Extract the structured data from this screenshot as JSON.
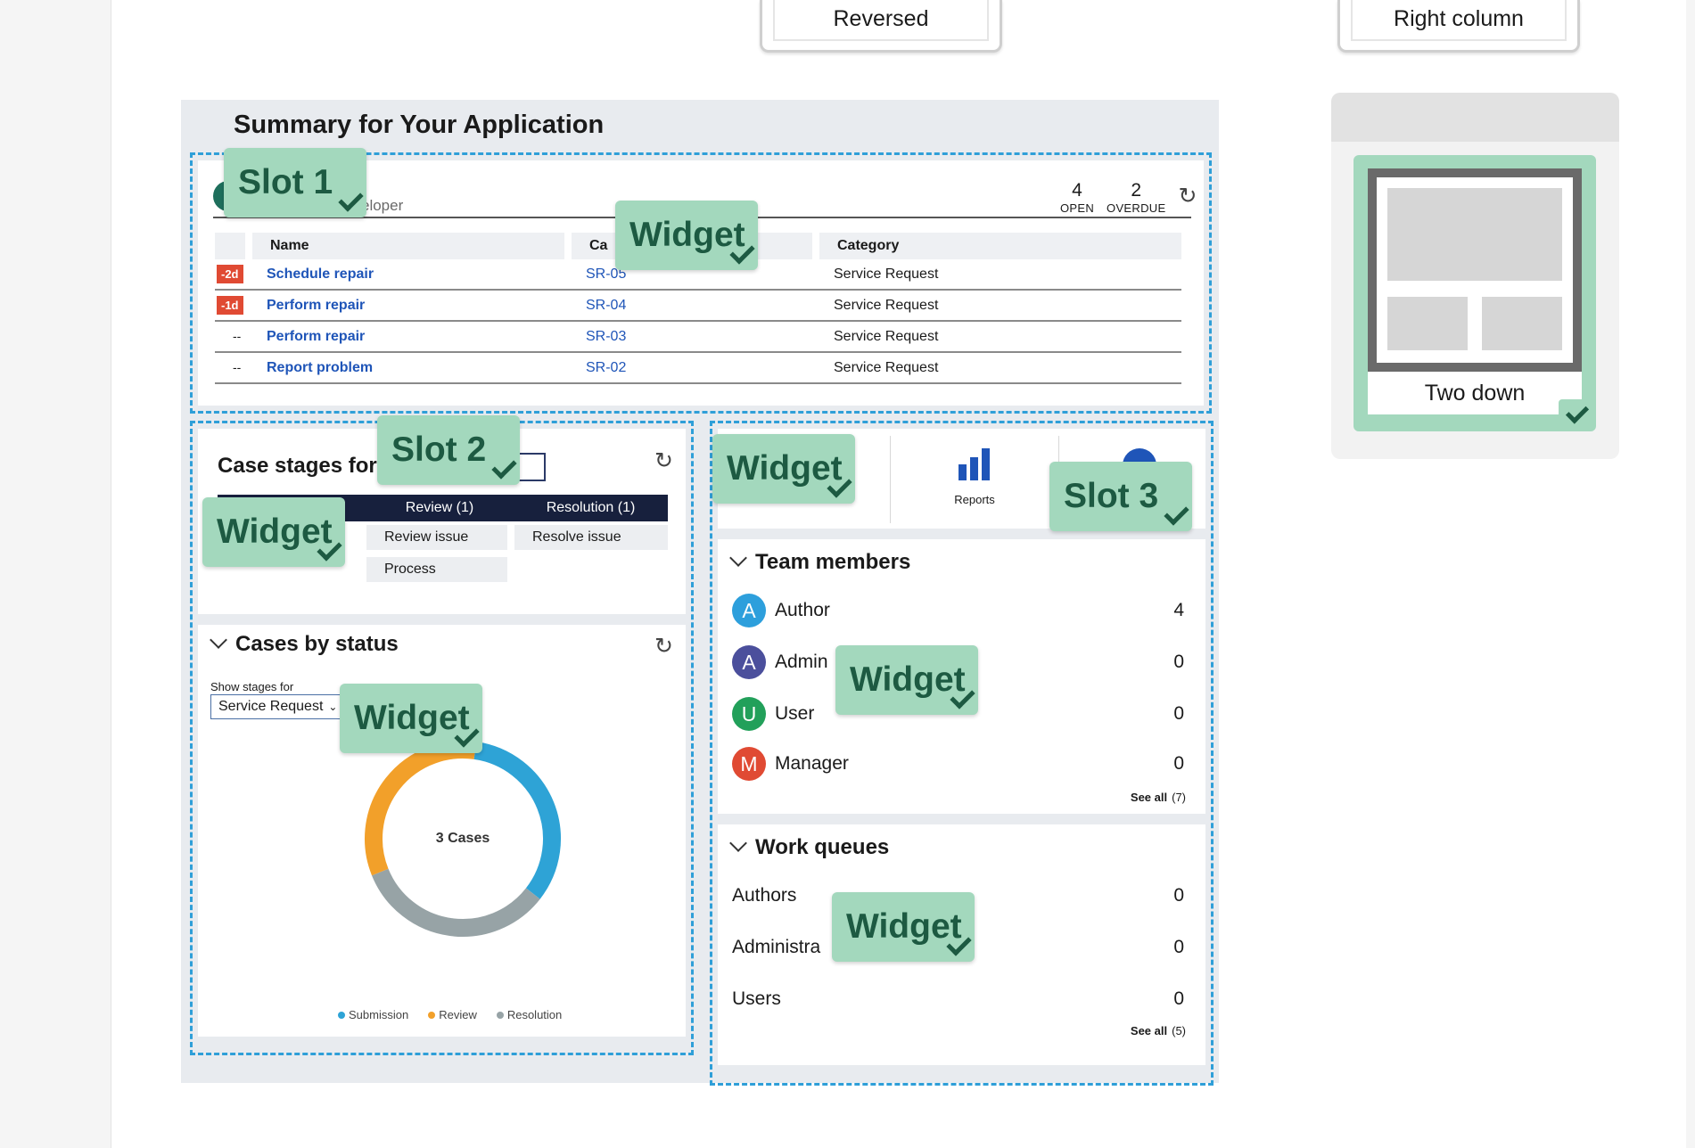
{
  "layout_options": [
    {
      "label": "Reversed"
    },
    {
      "label": "Right column"
    }
  ],
  "summary": {
    "title": "Summary for Your Application",
    "slot1": {
      "role_text": "eloper",
      "open_count": "4",
      "open_label": "OPEN",
      "overdue_count": "2",
      "overdue_label": "OVERDUE",
      "columns": [
        "",
        "Name",
        "Ca",
        "Category"
      ],
      "rows": [
        {
          "urgency": "-2d",
          "name": "Schedule repair",
          "id": "SR-05",
          "category": "Service Request"
        },
        {
          "urgency": "-1d",
          "name": "Perform repair",
          "id": "SR-04",
          "category": "Service Request"
        },
        {
          "urgency": "--",
          "name": "Perform repair",
          "id": "SR-03",
          "category": "Service Request"
        },
        {
          "urgency": "--",
          "name": "Report problem",
          "id": "SR-02",
          "category": "Service Request"
        }
      ]
    },
    "case_stages": {
      "heading": "Case stages for",
      "stages": [
        "Review  (1)",
        "Resolution  (1)"
      ],
      "tasks": [
        "Review issue",
        "Resolve issue",
        "Process"
      ]
    },
    "cases_by_status": {
      "heading": "Cases by status",
      "show_label": "Show stages for",
      "select_value": "Service Request",
      "center_text": "3 Cases",
      "legend": [
        "Submission",
        "Review",
        "Resolution"
      ]
    },
    "tiles": {
      "reports_label": "Reports"
    },
    "team_members": {
      "heading": "Team members",
      "members": [
        {
          "initial": "A",
          "name": "Author",
          "count": "4"
        },
        {
          "initial": "A",
          "name": "Admin",
          "count": "0"
        },
        {
          "initial": "U",
          "name": "User",
          "count": "0"
        },
        {
          "initial": "M",
          "name": "Manager",
          "count": "0"
        }
      ],
      "see_all": "See all",
      "see_all_count": "(7)"
    },
    "work_queues": {
      "heading": "Work queues",
      "queues": [
        {
          "name": "Authors",
          "count": "0"
        },
        {
          "name": "Administra",
          "count": "0"
        },
        {
          "name": "Users",
          "count": "0"
        }
      ],
      "see_all": "See all",
      "see_all_count": "(5)"
    }
  },
  "tags": {
    "slot1": "Slot 1",
    "slot2": "Slot 2",
    "slot3": "Slot 3",
    "widget": "Widget"
  },
  "preview": {
    "label": "Two down"
  },
  "chart_data": {
    "type": "pie",
    "title": "Cases by status",
    "center_label": "3 Cases",
    "categories": [
      "Submission",
      "Review",
      "Resolution"
    ],
    "values": [
      1,
      1,
      1
    ],
    "colors": {
      "Submission": "#2ea3d6",
      "Review": "#f2a02a",
      "Resolution": "#97a3a6"
    }
  },
  "colors": {
    "slot_border": "#2f9fd8",
    "tag_bg": "#a3d8bd",
    "tag_text": "#1d5a42",
    "stage_bar": "#17203d",
    "link": "#1f55b8",
    "urgency_badge": "#e04a33",
    "avatar_author": "#2d9fdc",
    "avatar_admin": "#4b4f9c",
    "avatar_user": "#22a05a",
    "avatar_manager": "#e04a33"
  }
}
